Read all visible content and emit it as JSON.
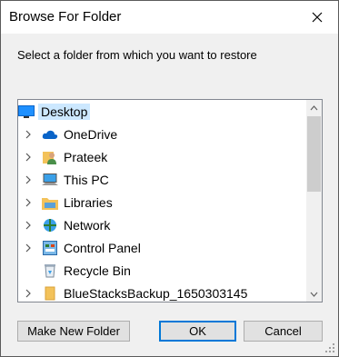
{
  "window": {
    "title": "Browse For Folder"
  },
  "instruction": "Select a folder from which you want to restore",
  "tree": {
    "items": [
      {
        "label": "Desktop",
        "icon": "desktop-icon",
        "selected": true,
        "expandable": false
      },
      {
        "label": "OneDrive",
        "icon": "onedrive-icon",
        "expandable": true
      },
      {
        "label": "Prateek",
        "icon": "user-folder-icon",
        "expandable": true
      },
      {
        "label": "This PC",
        "icon": "computer-icon",
        "expandable": true
      },
      {
        "label": "Libraries",
        "icon": "libraries-icon",
        "expandable": true
      },
      {
        "label": "Network",
        "icon": "network-icon",
        "expandable": true
      },
      {
        "label": "Control Panel",
        "icon": "control-panel-icon",
        "expandable": true
      },
      {
        "label": "Recycle Bin",
        "icon": "recycle-bin-icon",
        "expandable": false
      },
      {
        "label": "BlueStacksBackup_1650303145",
        "icon": "folder-icon",
        "expandable": true
      }
    ]
  },
  "buttons": {
    "make_new_folder": "Make New Folder",
    "ok": "OK",
    "cancel": "Cancel"
  },
  "colors": {
    "accent": "#0078d7",
    "selection": "#cce8ff"
  }
}
